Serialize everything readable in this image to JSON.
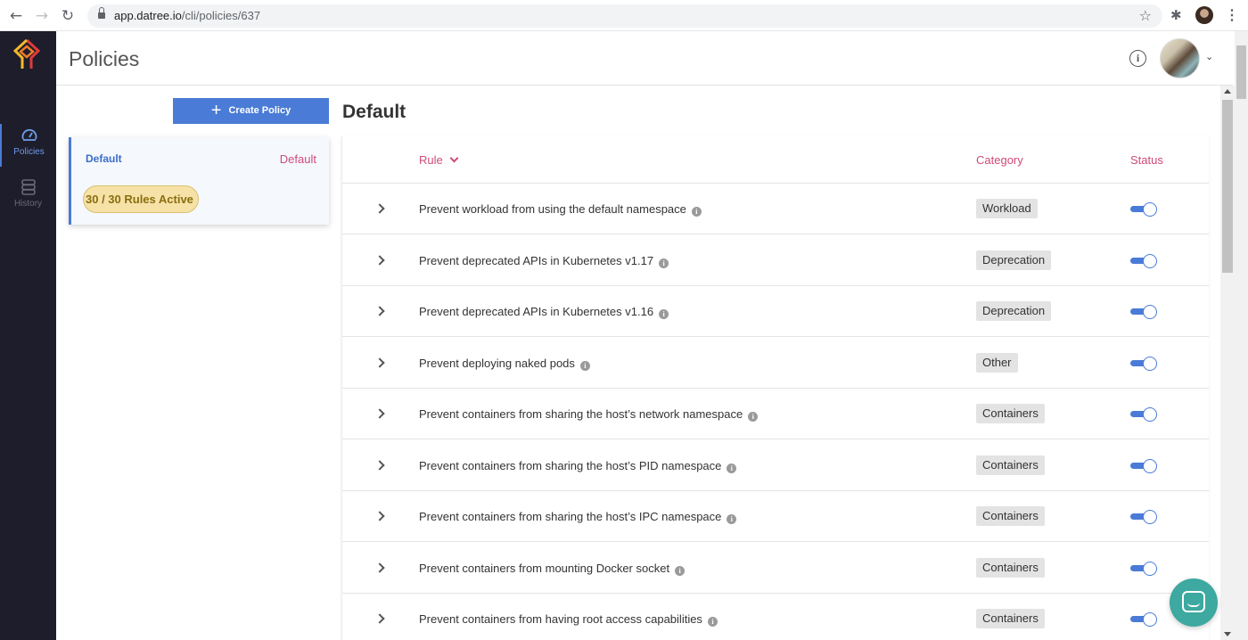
{
  "browser": {
    "url_host": "app.datree.io",
    "url_path": "/cli/policies/637"
  },
  "sidebar": {
    "items": [
      {
        "label": "Policies",
        "icon": "dashboard-gauge-icon",
        "active": true
      },
      {
        "label": "History",
        "icon": "database-stack-icon",
        "active": false
      }
    ]
  },
  "header": {
    "title": "Policies"
  },
  "policies_panel": {
    "create_label": "Create Policy",
    "policy": {
      "name": "Default",
      "tag": "Default",
      "rules_active": "30 / 30 Rules Active"
    }
  },
  "main": {
    "title": "Default",
    "columns": {
      "rule": "Rule",
      "category": "Category",
      "status": "Status"
    },
    "rows": [
      {
        "rule": "Prevent workload from using the default namespace",
        "category": "Workload",
        "enabled": true
      },
      {
        "rule": "Prevent deprecated APIs in Kubernetes v1.17",
        "category": "Deprecation",
        "enabled": true
      },
      {
        "rule": "Prevent deprecated APIs in Kubernetes v1.16",
        "category": "Deprecation",
        "enabled": true
      },
      {
        "rule": "Prevent deploying naked pods",
        "category": "Other",
        "enabled": true
      },
      {
        "rule": "Prevent containers from sharing the host’s network namespace",
        "category": "Containers",
        "enabled": true
      },
      {
        "rule": "Prevent containers from sharing the host’s PID namespace",
        "category": "Containers",
        "enabled": true
      },
      {
        "rule": "Prevent containers from sharing the host’s IPC namespace",
        "category": "Containers",
        "enabled": true
      },
      {
        "rule": "Prevent containers from mounting Docker socket",
        "category": "Containers",
        "enabled": true
      },
      {
        "rule": "Prevent containers from having root access capabilities",
        "category": "Containers",
        "enabled": true
      }
    ]
  },
  "colors": {
    "accent": "#4a7bd6",
    "pink": "#d04a7a",
    "sidebar_bg": "#1e1d2b",
    "chat": "#3da9a0"
  }
}
